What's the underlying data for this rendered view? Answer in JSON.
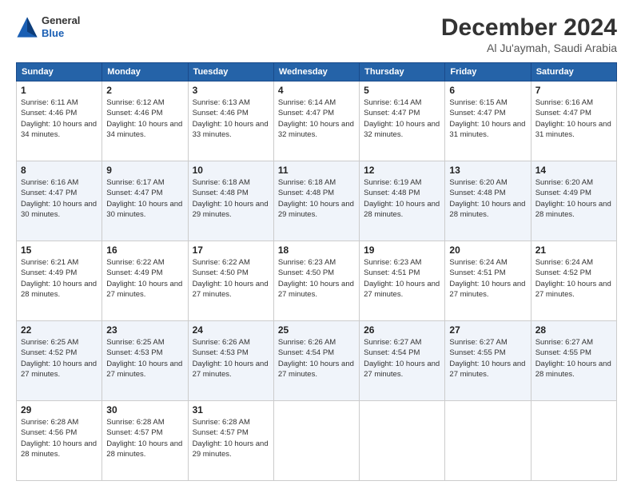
{
  "header": {
    "logo_general": "General",
    "logo_blue": "Blue",
    "month_title": "December 2024",
    "location": "Al Ju'aymah, Saudi Arabia"
  },
  "weekdays": [
    "Sunday",
    "Monday",
    "Tuesday",
    "Wednesday",
    "Thursday",
    "Friday",
    "Saturday"
  ],
  "weeks": [
    [
      {
        "day": "1",
        "sunrise": "6:11 AM",
        "sunset": "4:46 PM",
        "daylight": "10 hours and 34 minutes."
      },
      {
        "day": "2",
        "sunrise": "6:12 AM",
        "sunset": "4:46 PM",
        "daylight": "10 hours and 34 minutes."
      },
      {
        "day": "3",
        "sunrise": "6:13 AM",
        "sunset": "4:46 PM",
        "daylight": "10 hours and 33 minutes."
      },
      {
        "day": "4",
        "sunrise": "6:14 AM",
        "sunset": "4:47 PM",
        "daylight": "10 hours and 32 minutes."
      },
      {
        "day": "5",
        "sunrise": "6:14 AM",
        "sunset": "4:47 PM",
        "daylight": "10 hours and 32 minutes."
      },
      {
        "day": "6",
        "sunrise": "6:15 AM",
        "sunset": "4:47 PM",
        "daylight": "10 hours and 31 minutes."
      },
      {
        "day": "7",
        "sunrise": "6:16 AM",
        "sunset": "4:47 PM",
        "daylight": "10 hours and 31 minutes."
      }
    ],
    [
      {
        "day": "8",
        "sunrise": "6:16 AM",
        "sunset": "4:47 PM",
        "daylight": "10 hours and 30 minutes."
      },
      {
        "day": "9",
        "sunrise": "6:17 AM",
        "sunset": "4:47 PM",
        "daylight": "10 hours and 30 minutes."
      },
      {
        "day": "10",
        "sunrise": "6:18 AM",
        "sunset": "4:48 PM",
        "daylight": "10 hours and 29 minutes."
      },
      {
        "day": "11",
        "sunrise": "6:18 AM",
        "sunset": "4:48 PM",
        "daylight": "10 hours and 29 minutes."
      },
      {
        "day": "12",
        "sunrise": "6:19 AM",
        "sunset": "4:48 PM",
        "daylight": "10 hours and 28 minutes."
      },
      {
        "day": "13",
        "sunrise": "6:20 AM",
        "sunset": "4:48 PM",
        "daylight": "10 hours and 28 minutes."
      },
      {
        "day": "14",
        "sunrise": "6:20 AM",
        "sunset": "4:49 PM",
        "daylight": "10 hours and 28 minutes."
      }
    ],
    [
      {
        "day": "15",
        "sunrise": "6:21 AM",
        "sunset": "4:49 PM",
        "daylight": "10 hours and 28 minutes."
      },
      {
        "day": "16",
        "sunrise": "6:22 AM",
        "sunset": "4:49 PM",
        "daylight": "10 hours and 27 minutes."
      },
      {
        "day": "17",
        "sunrise": "6:22 AM",
        "sunset": "4:50 PM",
        "daylight": "10 hours and 27 minutes."
      },
      {
        "day": "18",
        "sunrise": "6:23 AM",
        "sunset": "4:50 PM",
        "daylight": "10 hours and 27 minutes."
      },
      {
        "day": "19",
        "sunrise": "6:23 AM",
        "sunset": "4:51 PM",
        "daylight": "10 hours and 27 minutes."
      },
      {
        "day": "20",
        "sunrise": "6:24 AM",
        "sunset": "4:51 PM",
        "daylight": "10 hours and 27 minutes."
      },
      {
        "day": "21",
        "sunrise": "6:24 AM",
        "sunset": "4:52 PM",
        "daylight": "10 hours and 27 minutes."
      }
    ],
    [
      {
        "day": "22",
        "sunrise": "6:25 AM",
        "sunset": "4:52 PM",
        "daylight": "10 hours and 27 minutes."
      },
      {
        "day": "23",
        "sunrise": "6:25 AM",
        "sunset": "4:53 PM",
        "daylight": "10 hours and 27 minutes."
      },
      {
        "day": "24",
        "sunrise": "6:26 AM",
        "sunset": "4:53 PM",
        "daylight": "10 hours and 27 minutes."
      },
      {
        "day": "25",
        "sunrise": "6:26 AM",
        "sunset": "4:54 PM",
        "daylight": "10 hours and 27 minutes."
      },
      {
        "day": "26",
        "sunrise": "6:27 AM",
        "sunset": "4:54 PM",
        "daylight": "10 hours and 27 minutes."
      },
      {
        "day": "27",
        "sunrise": "6:27 AM",
        "sunset": "4:55 PM",
        "daylight": "10 hours and 27 minutes."
      },
      {
        "day": "28",
        "sunrise": "6:27 AM",
        "sunset": "4:55 PM",
        "daylight": "10 hours and 28 minutes."
      }
    ],
    [
      {
        "day": "29",
        "sunrise": "6:28 AM",
        "sunset": "4:56 PM",
        "daylight": "10 hours and 28 minutes."
      },
      {
        "day": "30",
        "sunrise": "6:28 AM",
        "sunset": "4:57 PM",
        "daylight": "10 hours and 28 minutes."
      },
      {
        "day": "31",
        "sunrise": "6:28 AM",
        "sunset": "4:57 PM",
        "daylight": "10 hours and 29 minutes."
      },
      null,
      null,
      null,
      null
    ]
  ]
}
